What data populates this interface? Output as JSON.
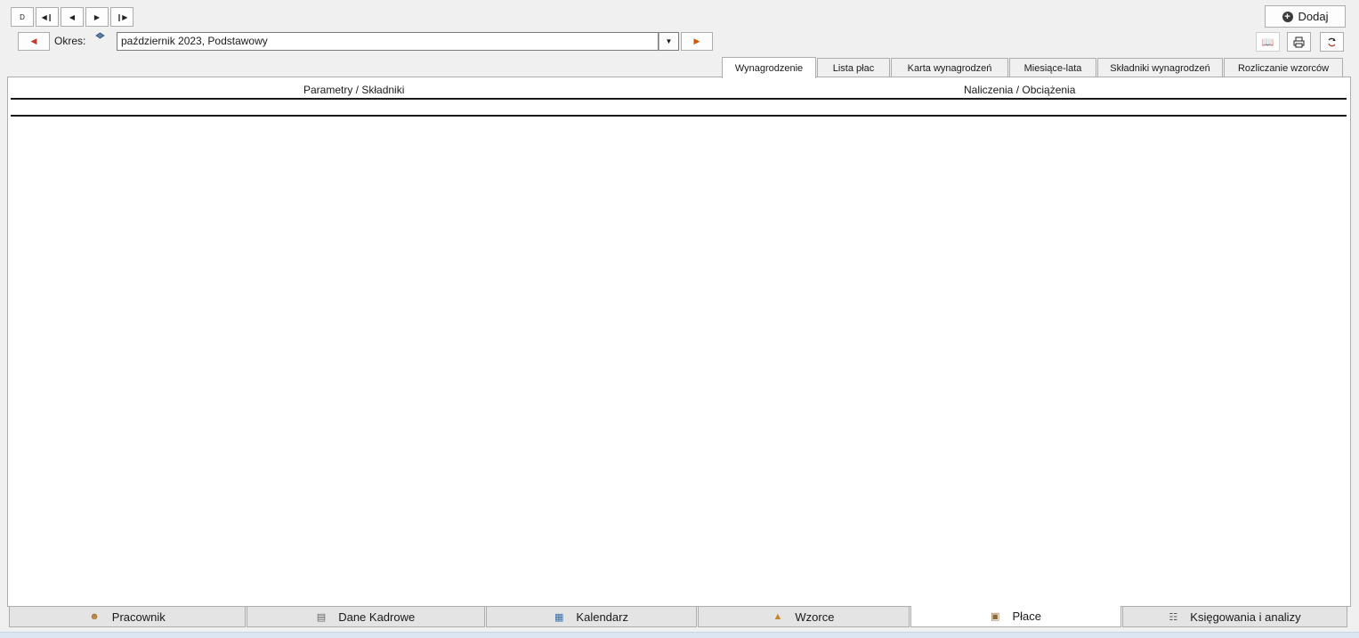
{
  "nav": {
    "first_label": "D",
    "first_record_icon": "first-record-icon",
    "prev_record_icon": "prev-record-icon",
    "next_record_icon": "next-record-icon",
    "last_record_icon": "last-record-icon"
  },
  "period": {
    "label": "Okres:",
    "value": "październik 2023, Podstawowy"
  },
  "toolbar": {
    "add_label": "Dodaj"
  },
  "tabs": [
    {
      "label": "Wynagrodzenie",
      "active": true
    },
    {
      "label": "Lista płac",
      "active": false
    },
    {
      "label": "Karta wynagrodzeń",
      "active": false
    },
    {
      "label": "Miesiące-lata",
      "active": false
    },
    {
      "label": "Składniki wynagrodzeń",
      "active": false
    },
    {
      "label": "Rozliczanie wzorców",
      "active": false
    }
  ],
  "grid": {
    "col_left": "Parametry / Składniki",
    "col_right": "Naliczenia / Obciążenia"
  },
  "bottom_tabs": [
    {
      "label": "Pracownik",
      "icon": "person-icon",
      "active": false
    },
    {
      "label": "Dane Kadrowe",
      "icon": "id-card-icon",
      "active": false
    },
    {
      "label": "Kalendarz",
      "icon": "calendar-icon",
      "active": false
    },
    {
      "label": "Wzorce",
      "icon": "templates-icon",
      "active": false
    },
    {
      "label": "Płace",
      "icon": "payroll-icon",
      "active": true
    },
    {
      "label": "Księgowania i analizy",
      "icon": "ledger-icon",
      "active": false
    }
  ],
  "colors": {
    "accent_red": "#c0392b",
    "accent_orange": "#d35400",
    "panel_bg": "#ffffff",
    "window_bg": "#f0f0f0"
  }
}
